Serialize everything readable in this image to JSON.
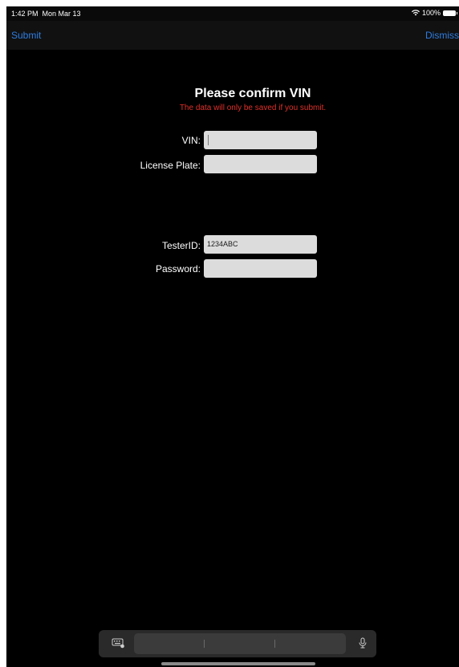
{
  "status_bar": {
    "time": "1:42 PM",
    "date": "Mon Mar 13",
    "battery": "100%",
    "wifi_icon": "wifi-icon",
    "battery_icon": "battery-icon"
  },
  "nav": {
    "submit_label": "Submit",
    "dismiss_label": "Dismiss",
    "accent_color": "#2f7de1"
  },
  "form": {
    "title": "Please confirm VIN",
    "subtitle": "The data will only be saved if you submit.",
    "subtitle_color": "#e0302a",
    "vin_label": "VIN:",
    "vin_value": "",
    "license_label": "License Plate:",
    "license_value": "",
    "tester_label": "TesterID:",
    "tester_value": "1234ABC",
    "password_label": "Password:",
    "password_value": ""
  },
  "keyboard": {
    "keyboard_icon": "keyboard-icon",
    "mic_icon": "microphone-icon"
  }
}
